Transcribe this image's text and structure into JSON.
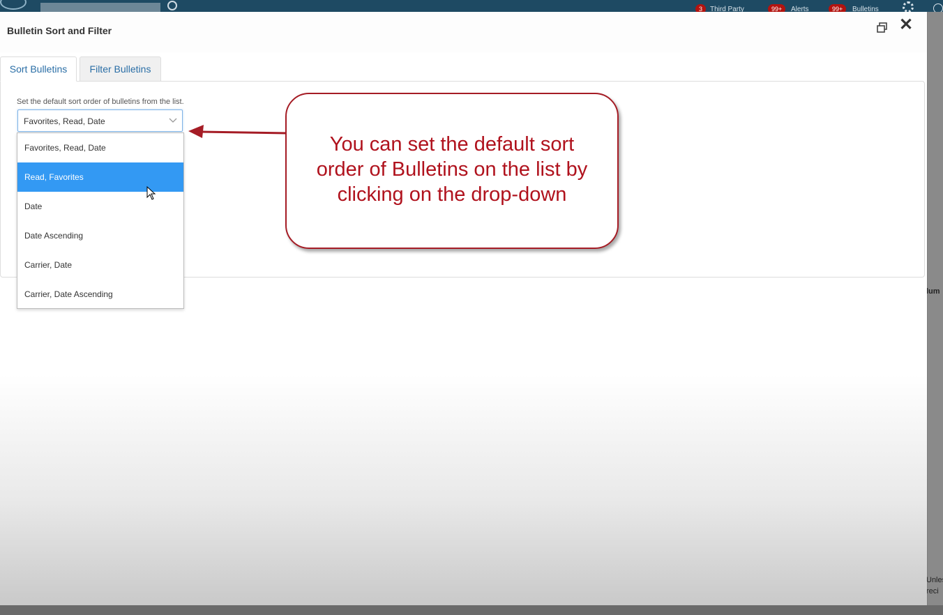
{
  "background_app": {
    "badges": [
      {
        "count": "3",
        "label": "Third Party"
      },
      {
        "count": "99+",
        "label": "Alerts"
      },
      {
        "count": "99+",
        "label": "Bulletins"
      }
    ],
    "right_edge_text": [
      "lum",
      "Unles",
      "reci"
    ]
  },
  "modal": {
    "title": "Bulletin Sort and Filter",
    "restore_icon": "restore-window-icon",
    "close_label": "✕"
  },
  "tabs": [
    {
      "label": "Sort Bulletins",
      "active": true
    },
    {
      "label": "Filter Bulletins",
      "active": false
    }
  ],
  "sort": {
    "hint": "Set the default sort order of bulletins from the list.",
    "selected_value": "Favorites, Read, Date",
    "options": [
      "Favorites, Read, Date",
      "Read, Favorites",
      "Date",
      "Date Ascending",
      "Carrier, Date",
      "Carrier, Date Ascending"
    ],
    "highlighted_index": 1
  },
  "callout": {
    "lines": [
      "You can set the default sort",
      "order of Bulletins on the list by",
      "clicking on the drop-down"
    ],
    "color": "#b0121d"
  }
}
